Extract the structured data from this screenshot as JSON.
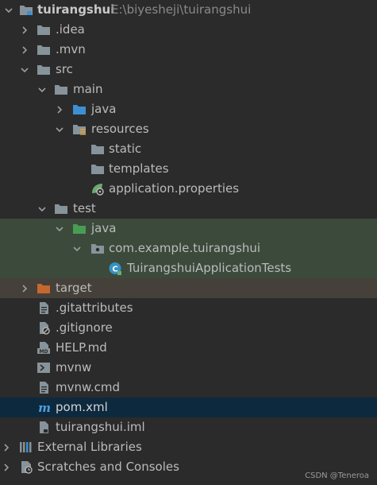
{
  "project": {
    "name": "tuirangshui",
    "path": "E:\\biyesheji\\tuirangshui"
  },
  "tree": {
    "idea": ".idea",
    "mvn": ".mvn",
    "src": "src",
    "main": "main",
    "main_java": "java",
    "resources": "resources",
    "static": "static",
    "templates": "templates",
    "app_properties": "application.properties",
    "test": "test",
    "test_java": "java",
    "package": "com.example.tuirangshui",
    "test_class": "TuirangshuiApplicationTests",
    "target": "target",
    "gitattributes": ".gitattributes",
    "gitignore": ".gitignore",
    "help": "HELP.md",
    "mvnw": "mvnw",
    "mvnw_cmd": "mvnw.cmd",
    "pom": "pom.xml",
    "iml": "tuirangshui.iml",
    "external_libraries": "External Libraries",
    "scratches": "Scratches and Consoles"
  },
  "icons": {
    "folder": "folder-icon",
    "source_folder": "source-folder-icon",
    "resources_folder": "resources-folder-icon",
    "test_folder": "test-source-folder-icon",
    "excluded_folder": "excluded-folder-icon",
    "package": "package-icon",
    "spring_config": "spring-properties-icon",
    "test_class": "java-class-icon",
    "text_file": "text-file-icon",
    "ignore_file": "ignore-file-icon",
    "markdown": "markdown-icon",
    "shell": "shell-script-icon",
    "maven": "maven-icon",
    "module": "module-file-icon",
    "libraries": "libraries-icon",
    "scratches": "scratches-icon"
  },
  "colors": {
    "background": "#2b2b2b",
    "selection": "#0d293e",
    "test_highlight": "#3c4a3c",
    "excluded_highlight": "#45403a",
    "folder": "#87939a",
    "source_folder": "#3d8fd1",
    "test_folder": "#499c54",
    "excluded_folder": "#c5682e",
    "text": "#bbbbbb"
  },
  "watermark": "CSDN @Teneroa"
}
